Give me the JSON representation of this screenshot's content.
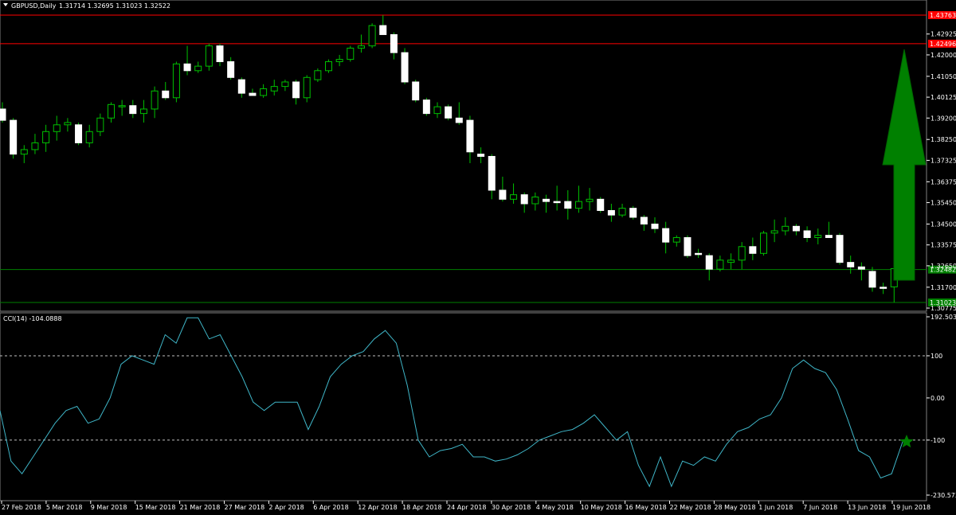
{
  "header": {
    "symbol_label": "GBPUSD,Daily",
    "ohlc_label": "1.31714 1.32695 1.31023 1.32522"
  },
  "cci_header": "CCI(14) -104.0888",
  "colors": {
    "background": "#000000",
    "bull_body": "#000000",
    "bear_body": "#ffffff",
    "wick_bull": "#00c000",
    "resistance_line": "#ff0000",
    "support_line": "#008000",
    "cci_line": "#3fb6c8",
    "arrow": "#008000",
    "grid": "#808080"
  },
  "icons": {
    "arrow": "up-arrow-icon",
    "star": "star-icon",
    "dropdown": "triangle-down-icon"
  },
  "chart_data": [
    {
      "type": "candlestick",
      "title": "GBPUSD,Daily",
      "ylim": [
        1.30775,
        1.44
      ],
      "price_axis_ticks": [
        "1.42925",
        "1.42000",
        "1.41050",
        "1.40125",
        "1.39200",
        "1.38250",
        "1.37325",
        "1.36375",
        "1.35450",
        "1.34500",
        "1.33575",
        "1.32650",
        "1.31700",
        "1.30775"
      ],
      "horizontal_lines": [
        {
          "value": 1.43763,
          "label": "1.43763",
          "color": "#ff0000"
        },
        {
          "value": 1.42496,
          "label": "1.42496",
          "color": "#ff0000"
        },
        {
          "value": 1.32482,
          "label": "1.32482",
          "color": "#008000"
        },
        {
          "value": 1.31023,
          "label": "1.31023",
          "color": "#008000"
        }
      ],
      "candles": [
        {
          "o": 1.396,
          "h": 1.399,
          "l": 1.39,
          "c": 1.391
        },
        {
          "o": 1.391,
          "h": 1.392,
          "l": 1.374,
          "c": 1.376
        },
        {
          "o": 1.376,
          "h": 1.38,
          "l": 1.372,
          "c": 1.378
        },
        {
          "o": 1.378,
          "h": 1.385,
          "l": 1.376,
          "c": 1.381
        },
        {
          "o": 1.381,
          "h": 1.389,
          "l": 1.377,
          "c": 1.386
        },
        {
          "o": 1.386,
          "h": 1.393,
          "l": 1.382,
          "c": 1.389
        },
        {
          "o": 1.389,
          "h": 1.392,
          "l": 1.386,
          "c": 1.39
        },
        {
          "o": 1.389,
          "h": 1.39,
          "l": 1.38,
          "c": 1.381
        },
        {
          "o": 1.381,
          "h": 1.389,
          "l": 1.379,
          "c": 1.386
        },
        {
          "o": 1.386,
          "h": 1.394,
          "l": 1.384,
          "c": 1.392
        },
        {
          "o": 1.392,
          "h": 1.399,
          "l": 1.39,
          "c": 1.398
        },
        {
          "o": 1.397,
          "h": 1.4,
          "l": 1.393,
          "c": 1.3975
        },
        {
          "o": 1.3975,
          "h": 1.4,
          "l": 1.392,
          "c": 1.394
        },
        {
          "o": 1.394,
          "h": 1.4,
          "l": 1.39,
          "c": 1.396
        },
        {
          "o": 1.396,
          "h": 1.406,
          "l": 1.392,
          "c": 1.404
        },
        {
          "o": 1.404,
          "h": 1.408,
          "l": 1.4,
          "c": 1.401
        },
        {
          "o": 1.401,
          "h": 1.417,
          "l": 1.399,
          "c": 1.416
        },
        {
          "o": 1.416,
          "h": 1.424,
          "l": 1.411,
          "c": 1.413
        },
        {
          "o": 1.413,
          "h": 1.417,
          "l": 1.412,
          "c": 1.415
        },
        {
          "o": 1.415,
          "h": 1.425,
          "l": 1.413,
          "c": 1.424
        },
        {
          "o": 1.424,
          "h": 1.425,
          "l": 1.415,
          "c": 1.417
        },
        {
          "o": 1.417,
          "h": 1.419,
          "l": 1.409,
          "c": 1.41
        },
        {
          "o": 1.409,
          "h": 1.41,
          "l": 1.401,
          "c": 1.403
        },
        {
          "o": 1.403,
          "h": 1.405,
          "l": 1.402,
          "c": 1.402
        },
        {
          "o": 1.402,
          "h": 1.407,
          "l": 1.401,
          "c": 1.405
        },
        {
          "o": 1.404,
          "h": 1.409,
          "l": 1.402,
          "c": 1.406
        },
        {
          "o": 1.406,
          "h": 1.409,
          "l": 1.404,
          "c": 1.408
        },
        {
          "o": 1.408,
          "h": 1.409,
          "l": 1.398,
          "c": 1.401
        },
        {
          "o": 1.401,
          "h": 1.411,
          "l": 1.399,
          "c": 1.41
        },
        {
          "o": 1.409,
          "h": 1.414,
          "l": 1.408,
          "c": 1.413
        },
        {
          "o": 1.413,
          "h": 1.418,
          "l": 1.412,
          "c": 1.417
        },
        {
          "o": 1.417,
          "h": 1.42,
          "l": 1.415,
          "c": 1.418
        },
        {
          "o": 1.418,
          "h": 1.424,
          "l": 1.417,
          "c": 1.423
        },
        {
          "o": 1.423,
          "h": 1.429,
          "l": 1.421,
          "c": 1.424
        },
        {
          "o": 1.424,
          "h": 1.434,
          "l": 1.423,
          "c": 1.433
        },
        {
          "o": 1.433,
          "h": 1.4376,
          "l": 1.429,
          "c": 1.429
        },
        {
          "o": 1.429,
          "h": 1.43,
          "l": 1.418,
          "c": 1.421
        },
        {
          "o": 1.421,
          "h": 1.423,
          "l": 1.407,
          "c": 1.408
        },
        {
          "o": 1.408,
          "h": 1.409,
          "l": 1.399,
          "c": 1.4
        },
        {
          "o": 1.4,
          "h": 1.401,
          "l": 1.393,
          "c": 1.394
        },
        {
          "o": 1.394,
          "h": 1.399,
          "l": 1.392,
          "c": 1.397
        },
        {
          "o": 1.397,
          "h": 1.398,
          "l": 1.391,
          "c": 1.392
        },
        {
          "o": 1.392,
          "h": 1.399,
          "l": 1.389,
          "c": 1.39
        },
        {
          "o": 1.391,
          "h": 1.393,
          "l": 1.372,
          "c": 1.377
        },
        {
          "o": 1.376,
          "h": 1.379,
          "l": 1.372,
          "c": 1.375
        },
        {
          "o": 1.375,
          "h": 1.376,
          "l": 1.356,
          "c": 1.36
        },
        {
          "o": 1.36,
          "h": 1.366,
          "l": 1.355,
          "c": 1.356
        },
        {
          "o": 1.356,
          "h": 1.363,
          "l": 1.354,
          "c": 1.358
        },
        {
          "o": 1.358,
          "h": 1.359,
          "l": 1.35,
          "c": 1.354
        },
        {
          "o": 1.354,
          "h": 1.359,
          "l": 1.351,
          "c": 1.357
        },
        {
          "o": 1.356,
          "h": 1.358,
          "l": 1.35,
          "c": 1.355
        },
        {
          "o": 1.355,
          "h": 1.362,
          "l": 1.351,
          "c": 1.355
        },
        {
          "o": 1.355,
          "h": 1.36,
          "l": 1.347,
          "c": 1.352
        },
        {
          "o": 1.352,
          "h": 1.362,
          "l": 1.35,
          "c": 1.355
        },
        {
          "o": 1.355,
          "h": 1.361,
          "l": 1.351,
          "c": 1.356
        },
        {
          "o": 1.356,
          "h": 1.357,
          "l": 1.35,
          "c": 1.351
        },
        {
          "o": 1.351,
          "h": 1.354,
          "l": 1.346,
          "c": 1.349
        },
        {
          "o": 1.349,
          "h": 1.354,
          "l": 1.348,
          "c": 1.352
        },
        {
          "o": 1.352,
          "h": 1.353,
          "l": 1.347,
          "c": 1.348
        },
        {
          "o": 1.348,
          "h": 1.349,
          "l": 1.342,
          "c": 1.345
        },
        {
          "o": 1.345,
          "h": 1.348,
          "l": 1.341,
          "c": 1.343
        },
        {
          "o": 1.343,
          "h": 1.346,
          "l": 1.332,
          "c": 1.337
        },
        {
          "o": 1.337,
          "h": 1.34,
          "l": 1.335,
          "c": 1.339
        },
        {
          "o": 1.339,
          "h": 1.34,
          "l": 1.33,
          "c": 1.331
        },
        {
          "o": 1.332,
          "h": 1.334,
          "l": 1.33,
          "c": 1.332
        },
        {
          "o": 1.331,
          "h": 1.332,
          "l": 1.32,
          "c": 1.325
        },
        {
          "o": 1.325,
          "h": 1.331,
          "l": 1.324,
          "c": 1.329
        },
        {
          "o": 1.328,
          "h": 1.332,
          "l": 1.325,
          "c": 1.329
        },
        {
          "o": 1.329,
          "h": 1.337,
          "l": 1.325,
          "c": 1.335
        },
        {
          "o": 1.335,
          "h": 1.339,
          "l": 1.329,
          "c": 1.332
        },
        {
          "o": 1.332,
          "h": 1.342,
          "l": 1.331,
          "c": 1.341
        },
        {
          "o": 1.341,
          "h": 1.347,
          "l": 1.337,
          "c": 1.342
        },
        {
          "o": 1.342,
          "h": 1.348,
          "l": 1.34,
          "c": 1.344
        },
        {
          "o": 1.344,
          "h": 1.345,
          "l": 1.34,
          "c": 1.342
        },
        {
          "o": 1.342,
          "h": 1.344,
          "l": 1.337,
          "c": 1.339
        },
        {
          "o": 1.339,
          "h": 1.343,
          "l": 1.336,
          "c": 1.34
        },
        {
          "o": 1.34,
          "h": 1.346,
          "l": 1.339,
          "c": 1.339
        },
        {
          "o": 1.34,
          "h": 1.341,
          "l": 1.327,
          "c": 1.328
        },
        {
          "o": 1.328,
          "h": 1.331,
          "l": 1.323,
          "c": 1.326
        },
        {
          "o": 1.326,
          "h": 1.328,
          "l": 1.32,
          "c": 1.325
        },
        {
          "o": 1.324,
          "h": 1.326,
          "l": 1.315,
          "c": 1.317
        },
        {
          "o": 1.317,
          "h": 1.319,
          "l": 1.314,
          "c": 1.317
        },
        {
          "o": 1.31714,
          "h": 1.32695,
          "l": 1.31023,
          "c": 1.32522
        }
      ],
      "annotations": [
        {
          "type": "up-arrow",
          "color": "#008000"
        }
      ]
    },
    {
      "type": "line",
      "title": "CCI(14) -104.0888",
      "ylim": [
        -230.573,
        192.5032
      ],
      "axis_labels": [
        "192.5032",
        "100",
        "0.00",
        "-100",
        "-230.573"
      ],
      "levels": [
        100,
        -100
      ],
      "x_labels": [
        "27 Feb 2018",
        "5 Mar 2018",
        "9 Mar 2018",
        "15 Mar 2018",
        "21 Mar 2018",
        "27 Mar 2018",
        "2 Apr 2018",
        "6 Apr 2018",
        "12 Apr 2018",
        "18 Apr 2018",
        "24 Apr 2018",
        "30 Apr 2018",
        "4 May 2018",
        "10 May 2018",
        "16 May 2018",
        "22 May 2018",
        "28 May 2018",
        "1 Jun 2018",
        "7 Jun 2018",
        "13 Jun 2018",
        "19 Jun 2018"
      ],
      "series": [
        {
          "values": [
            -30,
            -150,
            -180,
            -140,
            -100,
            -60,
            -30,
            -20,
            -60,
            -50,
            0,
            80,
            100,
            90,
            80,
            150,
            130,
            190,
            190,
            140,
            150,
            100,
            50,
            -10,
            -30,
            -10,
            -10,
            -10,
            -75,
            -20,
            50,
            80,
            100,
            110,
            140,
            160,
            130,
            30,
            -100,
            -140,
            -125,
            -120,
            -110,
            -140,
            -140,
            -150,
            -145,
            -135,
            -120,
            -100,
            -90,
            -80,
            -75,
            -60,
            -40,
            -70,
            -100,
            -80,
            -160,
            -210,
            -140,
            -210,
            -150,
            -160,
            -140,
            -150,
            -110,
            -80,
            -70,
            -50,
            -40,
            0,
            70,
            90,
            70,
            60,
            20,
            -50,
            -125,
            -140,
            -190,
            -180,
            -104.0888
          ]
        }
      ],
      "annotations": [
        {
          "type": "star",
          "value": -104.0888,
          "color": "#008000"
        }
      ]
    }
  ]
}
